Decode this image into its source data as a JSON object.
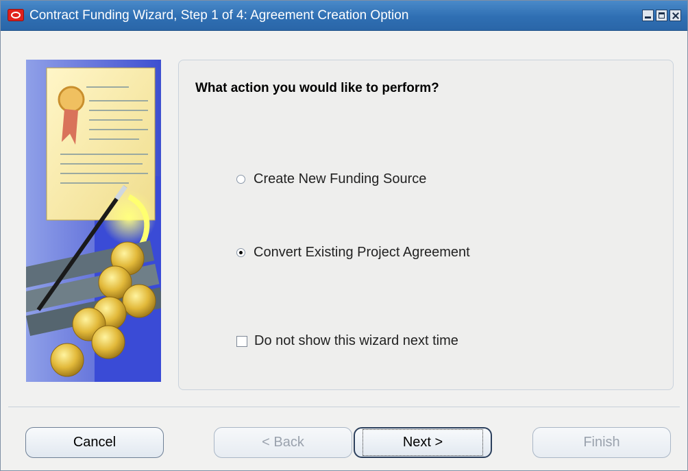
{
  "window": {
    "title": "Contract Funding Wizard, Step 1 of 4: Agreement Creation Option"
  },
  "content": {
    "question": "What action you would like to perform?",
    "options": [
      {
        "label": "Create New Funding Source",
        "selected": false
      },
      {
        "label": "Convert Existing Project Agreement",
        "selected": true
      }
    ],
    "checkbox": {
      "label": "Do not show this wizard next time",
      "checked": false
    }
  },
  "buttons": {
    "cancel": "Cancel",
    "back": "< Back",
    "next": "Next >",
    "finish": "Finish"
  },
  "colors": {
    "title_bar": "#2f6fb3",
    "window_bg": "#f1f1f0",
    "disabled_text": "#9aa2ad"
  },
  "icons": {
    "app": "oracle-logo-icon",
    "minimize": "minimize-icon",
    "maximize": "maximize-icon",
    "close": "close-icon",
    "illustration": "certificate-pen-coins-illustration"
  }
}
